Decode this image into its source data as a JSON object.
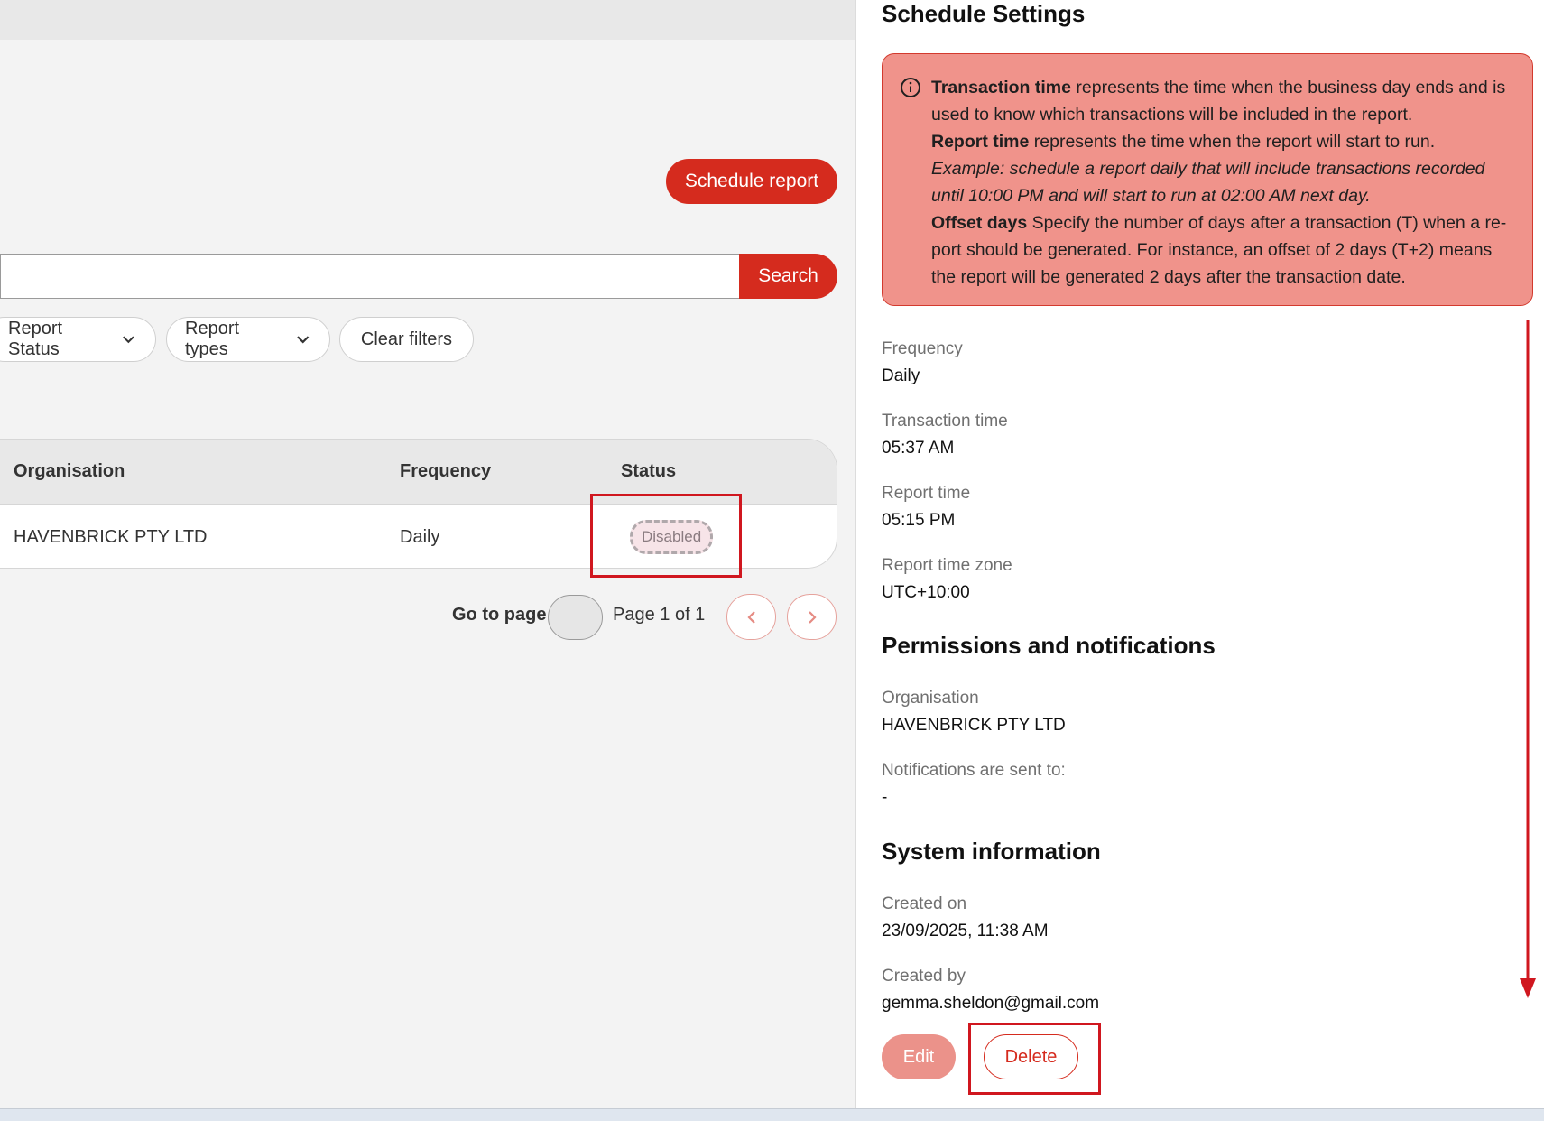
{
  "left": {
    "schedule_report_label": "Schedule report",
    "search": {
      "placeholder": "",
      "button_label": "Search"
    },
    "filters": {
      "report_status": "Report Status",
      "report_types": "Report types",
      "clear": "Clear filters"
    },
    "table": {
      "headers": {
        "organisation": "Organisation",
        "frequency": "Frequency",
        "status": "Status"
      },
      "rows": [
        {
          "organisation": "HAVENBRICK PTY LTD",
          "frequency": "Daily",
          "status": "Disabled"
        }
      ]
    },
    "pager": {
      "go_to_label": "Go to page",
      "page_text": "Page 1 of 1"
    }
  },
  "right": {
    "title": "Schedule Settings",
    "info": {
      "transaction_time_term": "Transaction time",
      "transaction_time_text": "represents the time when the business day ends and is used to know which transactions will be included in the report.",
      "report_time_term": "Report time",
      "report_time_text": "represents the time when the report will start to run.",
      "example": "Example: schedule a report daily that will include transactions recorded until 10:00 PM and will start to run at 02:00 AM next day.",
      "offset_term": "Offset days",
      "offset_text": "Specify the number of days after a transaction (T) when a re-port should be generated. For instance, an offset of 2 days (T+2) means the report will be generated 2 days after the transaction date."
    },
    "fields": {
      "frequency_label": "Frequency",
      "frequency_value": "Daily",
      "transaction_time_label": "Transaction time",
      "transaction_time_value": "05:37 AM",
      "report_time_label": "Report time",
      "report_time_value": "05:15 PM",
      "timezone_label": "Report time zone",
      "timezone_value": "UTC+10:00"
    },
    "permissions": {
      "title": "Permissions and notifications",
      "organisation_label": "Organisation",
      "organisation_value": "HAVENBRICK PTY LTD",
      "notifications_label": "Notifications are sent to:",
      "notifications_value": "-"
    },
    "system": {
      "title": "System information",
      "created_on_label": "Created on",
      "created_on_value": "23/09/2025, 11:38 AM",
      "created_by_label": "Created by",
      "created_by_value": "gemma.sheldon@gmail.com"
    },
    "buttons": {
      "edit": "Edit",
      "delete": "Delete"
    }
  },
  "colors": {
    "brand": "#d52b1e",
    "annotation": "#d0171f",
    "info_bg": "#f0938b"
  },
  "icons": [
    "chevron-down-icon",
    "info-icon",
    "chevron-left-icon",
    "chevron-right-icon"
  ]
}
